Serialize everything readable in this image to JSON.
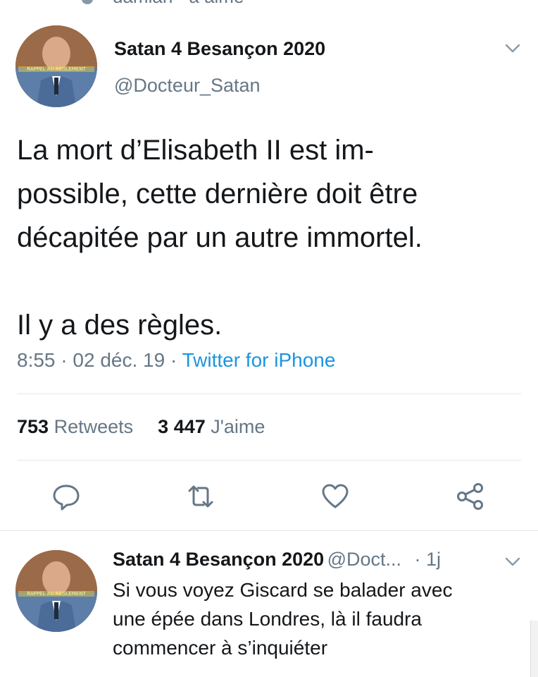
{
  "context": {
    "text": "damian · a aimé"
  },
  "tweet": {
    "author_name": "Satan 4 Besançon 2020",
    "author_handle": "@Docteur_Satan",
    "avatar_caption": "RAPPEL AU RÈGLEMENT",
    "text_lines": [
      "La mort d’Elisabeth II est im-",
      "possible, cette dernière doit être",
      "décapitée par un autre immortel.",
      "",
      "Il y a des règles."
    ],
    "time": "8:55",
    "date": "02 déc. 19",
    "client": "Twitter for iPhone",
    "retweets_count": "753",
    "retweets_label": "Retweets",
    "likes_count": "3 447",
    "likes_label": "J'aime"
  },
  "actions": {
    "icons": [
      "reply-icon",
      "retweet-icon",
      "like-icon",
      "share-icon"
    ]
  },
  "reply": {
    "author_name": "Satan 4 Besançon 2020",
    "author_handle": "@Doct...",
    "age": "· 1j",
    "avatar_caption": "RAPPEL AU RÈGLEMENT",
    "text_lines": [
      "Si vous voyez Giscard se balader avec",
      "une épée dans Londres, là il faudra",
      "commencer à s’inquiéter"
    ]
  },
  "colors": {
    "primary_text": "#14171a",
    "secondary_text": "#657786",
    "link": "#1b95e0",
    "divider": "#e1e8ed",
    "icon": "#657786"
  }
}
